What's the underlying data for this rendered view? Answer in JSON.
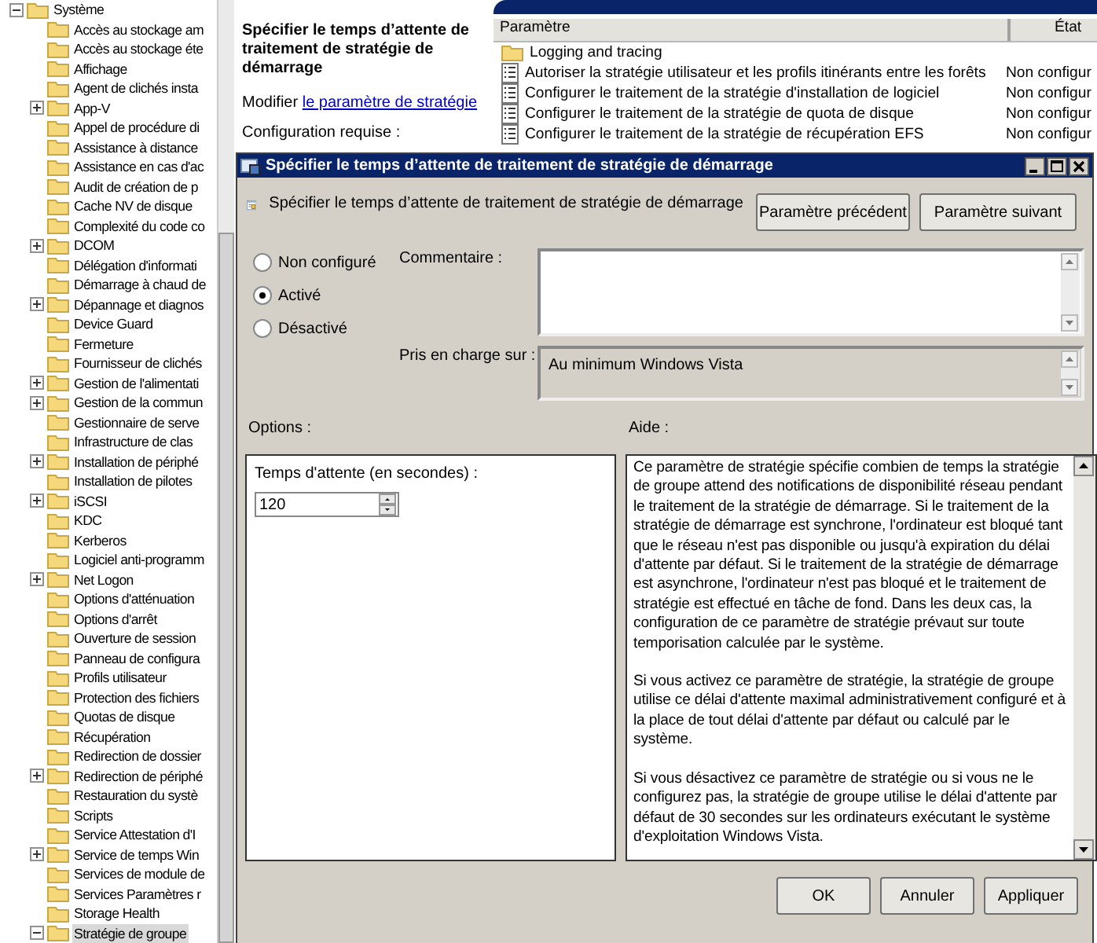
{
  "tree": {
    "items": [
      {
        "label": "Système",
        "expanded": true,
        "selected": false,
        "children": [
          {
            "label": "Accès au stockage am",
            "selected": false
          },
          {
            "label": "Accès au stockage éte",
            "selected": false
          },
          {
            "label": "Affichage",
            "selected": false
          },
          {
            "label": "Agent de clichés insta",
            "selected": false
          },
          {
            "label": "App-V",
            "expanded": false,
            "selected": false
          },
          {
            "label": "Appel de procédure di",
            "selected": false
          },
          {
            "label": "Assistance à distance",
            "selected": false
          },
          {
            "label": "Assistance en cas d'ac",
            "selected": false
          },
          {
            "label": "Audit de création de p",
            "selected": false
          },
          {
            "label": "Cache NV de disque",
            "selected": false
          },
          {
            "label": "Complexité du code co",
            "selected": false
          },
          {
            "label": "DCOM",
            "expanded": false,
            "selected": false
          },
          {
            "label": "Délégation d'informati",
            "selected": false
          },
          {
            "label": "Démarrage à chaud de",
            "selected": false
          },
          {
            "label": "Dépannage et diagnos",
            "expanded": false,
            "selected": false
          },
          {
            "label": "Device Guard",
            "selected": false
          },
          {
            "label": "Fermeture",
            "selected": false
          },
          {
            "label": "Fournisseur de clichés",
            "selected": false
          },
          {
            "label": "Gestion de l'alimentati",
            "expanded": false,
            "selected": false
          },
          {
            "label": "Gestion de la commun",
            "expanded": false,
            "selected": false
          },
          {
            "label": "Gestionnaire de serve",
            "selected": false
          },
          {
            "label": "Infrastructure de clas",
            "selected": false
          },
          {
            "label": "Installation de périphé",
            "expanded": false,
            "selected": false
          },
          {
            "label": "Installation de pilotes",
            "selected": false
          },
          {
            "label": "iSCSI",
            "expanded": false,
            "selected": false
          },
          {
            "label": "KDC",
            "selected": false
          },
          {
            "label": "Kerberos",
            "selected": false
          },
          {
            "label": "Logiciel anti-programm",
            "selected": false
          },
          {
            "label": "Net Logon",
            "expanded": false,
            "selected": false
          },
          {
            "label": "Options d'atténuation",
            "selected": false
          },
          {
            "label": "Options d'arrêt",
            "selected": false
          },
          {
            "label": "Ouverture de session",
            "selected": false
          },
          {
            "label": "Panneau de configura",
            "selected": false
          },
          {
            "label": "Profils utilisateur",
            "selected": false
          },
          {
            "label": "Protection des fichiers",
            "selected": false
          },
          {
            "label": "Quotas de disque",
            "selected": false
          },
          {
            "label": "Récupération",
            "selected": false
          },
          {
            "label": "Redirection de dossier",
            "selected": false
          },
          {
            "label": "Redirection de périphé",
            "expanded": false,
            "selected": false
          },
          {
            "label": "Restauration du systè",
            "selected": false
          },
          {
            "label": "Scripts",
            "selected": false
          },
          {
            "label": "Service Attestation d'I",
            "selected": false
          },
          {
            "label": "Service de temps Win",
            "expanded": false,
            "selected": false
          },
          {
            "label": "Services de module de",
            "selected": false
          },
          {
            "label": "Services Paramètres r",
            "selected": false
          },
          {
            "label": "Storage Health",
            "selected": false
          },
          {
            "label": "Stratégie de groupe",
            "expanded": true,
            "selected": true
          }
        ]
      }
    ]
  },
  "details": {
    "title": "Spécifier le temps d’attente de traitement de stratégie de démarrage",
    "edit_prefix": "Modifier",
    "edit_link": "le paramètre de stratégie",
    "requirements_label": "Configuration requise :"
  },
  "settings_list": {
    "columns": [
      "Paramètre",
      "État"
    ],
    "rows": [
      {
        "kind": "folder",
        "name": "Logging and tracing"
      },
      {
        "kind": "policy",
        "name": "Autoriser la stratégie utilisateur et les profils itinérants entre les forêts",
        "state": "Non configur"
      },
      {
        "kind": "policy",
        "name": "Configurer le traitement de la stratégie d'installation de logiciel",
        "state": "Non configur"
      },
      {
        "kind": "policy",
        "name": "Configurer le traitement de la stratégie de quota de disque",
        "state": "Non configur"
      },
      {
        "kind": "policy",
        "name": "Configurer le traitement de la stratégie de récupération EFS",
        "state": "Non configur"
      }
    ]
  },
  "dialog": {
    "title": "Spécifier le temps d’attente de traitement de stratégie de démarrage",
    "heading": "Spécifier le temps d’attente de traitement de stratégie de démarrage",
    "nav_buttons": [
      "Paramètre précédent",
      "Paramètre suivant"
    ],
    "radios": [
      {
        "label": "Non configuré",
        "selected": false
      },
      {
        "label": "Activé",
        "selected": true
      },
      {
        "label": "Désactivé",
        "selected": false
      }
    ],
    "comment_label": "Commentaire :",
    "supported_label": "Pris en charge sur :",
    "supported_value": "Au minimum Windows Vista",
    "options_label": "Options :",
    "help_label": "Aide :",
    "timeout_label": "Temps d'attente (en secondes) :",
    "timeout_value": "120",
    "help": [
      "Ce paramètre de stratégie spécifie combien de temps la stratégie de groupe attend des notifications de disponibilité réseau pendant le traitement de la stratégie de démarrage. Si le traitement de la stratégie de démarrage est synchrone, l'ordinateur est bloqué tant que le réseau n'est pas disponible ou jusqu'à expiration du délai d'attente par défaut. Si le traitement de la stratégie de démarrage est asynchrone, l'ordinateur n'est pas bloqué et le traitement de stratégie est effectué en tâche de fond. Dans les deux cas, la configuration de ce paramètre de stratégie prévaut sur toute temporisation calculée par le système.",
      "Si vous activez ce paramètre de stratégie, la stratégie de groupe utilise ce délai d'attente maximal administrativement configuré et à la place de tout délai d'attente par défaut ou calculé par le système.",
      "Si vous désactivez ce paramètre de stratégie ou si vous ne le configurez pas, la stratégie de groupe utilise le délai d'attente par défaut de 30 secondes sur les ordinateurs exécutant le système d'exploitation Windows Vista."
    ],
    "buttons": [
      "OK",
      "Annuler",
      "Appliquer"
    ]
  }
}
